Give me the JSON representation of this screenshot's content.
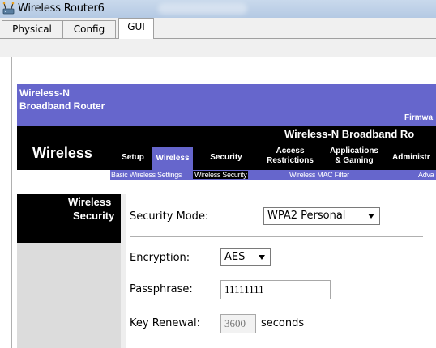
{
  "window": {
    "title": "Wireless Router6"
  },
  "tabs": [
    {
      "label": "Physical"
    },
    {
      "label": "Config"
    },
    {
      "label": "GUI"
    }
  ],
  "header": {
    "brand_line1": "Wireless-N",
    "brand_line2": "Broadband Router",
    "firmware": "Firmwa",
    "product": "Wireless-N Broadband Ro",
    "section": "Wireless"
  },
  "menu": [
    {
      "label": "Setup"
    },
    {
      "label": "Wireless"
    },
    {
      "label": "Security"
    },
    {
      "label": "Access\nRestrictions"
    },
    {
      "label": "Applications\n& Gaming"
    },
    {
      "label": "Administr"
    }
  ],
  "submenu": [
    {
      "label": "Basic Wireless Settings"
    },
    {
      "label": "Wireless Security"
    },
    {
      "label": "Wireless MAC Filter"
    },
    {
      "label": "Adva"
    }
  ],
  "sidebar": {
    "line1": "Wireless",
    "line2": "Security"
  },
  "form": {
    "security_mode": {
      "label": "Security Mode:",
      "value": "WPA2 Personal"
    },
    "encryption": {
      "label": "Encryption:",
      "value": "AES"
    },
    "passphrase": {
      "label": "Passphrase:",
      "value": "11111111"
    },
    "key_renewal": {
      "label": "Key Renewal:",
      "value": "3600",
      "unit": "seconds"
    }
  },
  "colors": {
    "accent": "#6666cc",
    "bar": "#000000",
    "side": "#dcdcdc"
  }
}
